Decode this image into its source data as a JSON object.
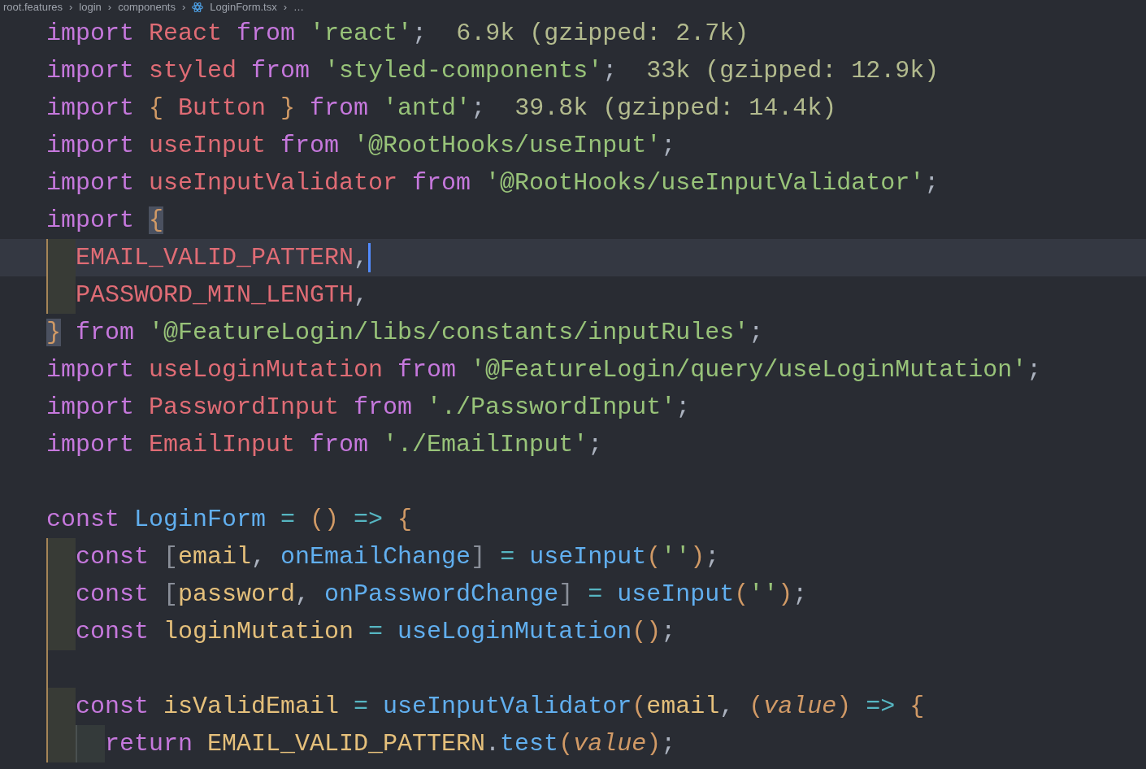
{
  "breadcrumb": {
    "separator": "›",
    "items": [
      {
        "text": "root.features",
        "kind": "folder"
      },
      {
        "text": "login",
        "kind": "folder"
      },
      {
        "text": "components",
        "kind": "folder"
      },
      {
        "text": "LoginForm.tsx",
        "kind": "file"
      },
      {
        "text": "…",
        "kind": "more"
      }
    ]
  },
  "editor": {
    "blocks": [
      {
        "lines": [
          {
            "tokens": [
              {
                "text": "import ",
                "kind": "keyword"
              },
              {
                "text": "React ",
                "kind": "name"
              },
              {
                "text": "from ",
                "kind": "keyword"
              },
              {
                "text": "'react'",
                "kind": "string"
              },
              {
                "text": ";  ",
                "kind": "punct"
              },
              {
                "text": "6.9k (gzipped: 2.7k)",
                "kind": "hint"
              }
            ]
          },
          {
            "tokens": [
              {
                "text": "import ",
                "kind": "keyword"
              },
              {
                "text": "styled ",
                "kind": "name"
              },
              {
                "text": "from ",
                "kind": "keyword"
              },
              {
                "text": "'styled-components'",
                "kind": "string"
              },
              {
                "text": ";  ",
                "kind": "punct"
              },
              {
                "text": "33k (gzipped: 12.9k)",
                "kind": "hint"
              }
            ]
          },
          {
            "tokens": [
              {
                "text": "import ",
                "kind": "keyword"
              },
              {
                "text": "{ ",
                "kind": "bracket"
              },
              {
                "text": "Button ",
                "kind": "name"
              },
              {
                "text": "} ",
                "kind": "bracket"
              },
              {
                "text": "from ",
                "kind": "keyword"
              },
              {
                "text": "'antd'",
                "kind": "string"
              },
              {
                "text": ";  ",
                "kind": "punct"
              },
              {
                "text": "39.8k (gzipped: 14.4k)",
                "kind": "hint"
              }
            ]
          },
          {
            "tokens": [
              {
                "text": "import ",
                "kind": "keyword"
              },
              {
                "text": "useInput ",
                "kind": "name"
              },
              {
                "text": "from ",
                "kind": "keyword"
              },
              {
                "text": "'@RootHooks/useInput'",
                "kind": "string"
              },
              {
                "text": ";",
                "kind": "punct"
              }
            ]
          },
          {
            "tokens": [
              {
                "text": "import ",
                "kind": "keyword"
              },
              {
                "text": "useInputValidator ",
                "kind": "name"
              },
              {
                "text": "from ",
                "kind": "keyword"
              },
              {
                "text": "'@RootHooks/useInputValidator'",
                "kind": "string"
              },
              {
                "text": ";",
                "kind": "punct"
              }
            ]
          },
          {
            "tokens": [
              {
                "text": "import ",
                "kind": "keyword"
              },
              {
                "text": "{",
                "kind": "matched"
              }
            ]
          },
          {
            "current": true,
            "cursor": true,
            "guides": [
              {
                "kind": "shaded"
              }
            ],
            "tokens": [
              {
                "text": "EMAIL_VALID_PATTERN",
                "kind": "name"
              },
              {
                "text": ",",
                "kind": "punct"
              }
            ]
          },
          {
            "guides": [
              {
                "kind": "shaded"
              }
            ],
            "tokens": [
              {
                "text": "PASSWORD_MIN_LENGTH",
                "kind": "name"
              },
              {
                "text": ",",
                "kind": "punct"
              }
            ]
          },
          {
            "tokens": [
              {
                "text": "}",
                "kind": "matched"
              },
              {
                "text": " from ",
                "kind": "keyword"
              },
              {
                "text": "'@FeatureLogin/libs/constants/inputRules'",
                "kind": "string"
              },
              {
                "text": ";",
                "kind": "punct"
              }
            ]
          },
          {
            "tokens": [
              {
                "text": "import ",
                "kind": "keyword"
              },
              {
                "text": "useLoginMutation ",
                "kind": "name"
              },
              {
                "text": "from ",
                "kind": "keyword"
              },
              {
                "text": "'@FeatureLogin/query/useLoginMutation'",
                "kind": "string"
              },
              {
                "text": ";",
                "kind": "punct"
              }
            ]
          },
          {
            "tokens": [
              {
                "text": "import ",
                "kind": "keyword"
              },
              {
                "text": "PasswordInput ",
                "kind": "name"
              },
              {
                "text": "from ",
                "kind": "keyword"
              },
              {
                "text": "'./PasswordInput'",
                "kind": "string"
              },
              {
                "text": ";",
                "kind": "punct"
              }
            ]
          },
          {
            "tokens": [
              {
                "text": "import ",
                "kind": "keyword"
              },
              {
                "text": "EmailInput ",
                "kind": "name"
              },
              {
                "text": "from ",
                "kind": "keyword"
              },
              {
                "text": "'./EmailInput'",
                "kind": "string"
              },
              {
                "text": ";",
                "kind": "punct"
              }
            ]
          }
        ]
      },
      {
        "lines": [
          {
            "tokens": [
              {
                "text": "const ",
                "kind": "keyword"
              },
              {
                "text": "LoginForm ",
                "kind": "function"
              },
              {
                "text": "= ",
                "kind": "operator"
              },
              {
                "text": "() ",
                "kind": "bracket"
              },
              {
                "text": "=> ",
                "kind": "operator"
              },
              {
                "text": "{",
                "kind": "bracket"
              }
            ]
          },
          {
            "guides": [
              {
                "kind": "shaded"
              }
            ],
            "tokens": [
              {
                "text": "const ",
                "kind": "keyword"
              },
              {
                "text": "[",
                "kind": "dim"
              },
              {
                "text": "email",
                "kind": "variable"
              },
              {
                "text": ", ",
                "kind": "punct"
              },
              {
                "text": "onEmailChange",
                "kind": "function"
              },
              {
                "text": "]",
                "kind": "dim"
              },
              {
                "text": " = ",
                "kind": "operator"
              },
              {
                "text": "useInput",
                "kind": "function"
              },
              {
                "text": "(",
                "kind": "bracket"
              },
              {
                "text": "''",
                "kind": "string"
              },
              {
                "text": ")",
                "kind": "bracket"
              },
              {
                "text": ";",
                "kind": "punct"
              }
            ]
          },
          {
            "guides": [
              {
                "kind": "shaded"
              }
            ],
            "tokens": [
              {
                "text": "const ",
                "kind": "keyword"
              },
              {
                "text": "[",
                "kind": "dim"
              },
              {
                "text": "password",
                "kind": "variable"
              },
              {
                "text": ", ",
                "kind": "punct"
              },
              {
                "text": "onPasswordChange",
                "kind": "function"
              },
              {
                "text": "]",
                "kind": "dim"
              },
              {
                "text": " = ",
                "kind": "operator"
              },
              {
                "text": "useInput",
                "kind": "function"
              },
              {
                "text": "(",
                "kind": "bracket"
              },
              {
                "text": "''",
                "kind": "string"
              },
              {
                "text": ")",
                "kind": "bracket"
              },
              {
                "text": ";",
                "kind": "punct"
              }
            ]
          },
          {
            "guides": [
              {
                "kind": "shaded"
              }
            ],
            "tokens": [
              {
                "text": "const ",
                "kind": "keyword"
              },
              {
                "text": "loginMutation ",
                "kind": "variable"
              },
              {
                "text": "= ",
                "kind": "operator"
              },
              {
                "text": "useLoginMutation",
                "kind": "function"
              },
              {
                "text": "()",
                "kind": "bracket"
              },
              {
                "text": ";",
                "kind": "punct"
              }
            ]
          },
          {
            "guides": [
              {
                "kind": "rule"
              }
            ]
          },
          {
            "guides": [
              {
                "kind": "shaded"
              }
            ],
            "tokens": [
              {
                "text": "const ",
                "kind": "keyword"
              },
              {
                "text": "isValidEmail ",
                "kind": "variable"
              },
              {
                "text": "= ",
                "kind": "operator"
              },
              {
                "text": "useInputValidator",
                "kind": "function"
              },
              {
                "text": "(",
                "kind": "bracket"
              },
              {
                "text": "email",
                "kind": "variable"
              },
              {
                "text": ", ",
                "kind": "punct"
              },
              {
                "text": "(",
                "kind": "bracket"
              },
              {
                "text": "value",
                "kind": "param"
              },
              {
                "text": ") ",
                "kind": "bracket"
              },
              {
                "text": "=> ",
                "kind": "operator"
              },
              {
                "text": "{",
                "kind": "bracket"
              }
            ]
          },
          {
            "guides": [
              {
                "kind": "shaded"
              },
              {
                "kind": "inner"
              }
            ],
            "tokens": [
              {
                "text": "return ",
                "kind": "keyword"
              },
              {
                "text": "EMAIL_VALID_PATTERN",
                "kind": "variable"
              },
              {
                "text": ".",
                "kind": "punct"
              },
              {
                "text": "test",
                "kind": "function"
              },
              {
                "text": "(",
                "kind": "bracket"
              },
              {
                "text": "value",
                "kind": "param"
              },
              {
                "text": ")",
                "kind": "bracket"
              },
              {
                "text": ";",
                "kind": "punct"
              }
            ]
          }
        ]
      }
    ]
  }
}
